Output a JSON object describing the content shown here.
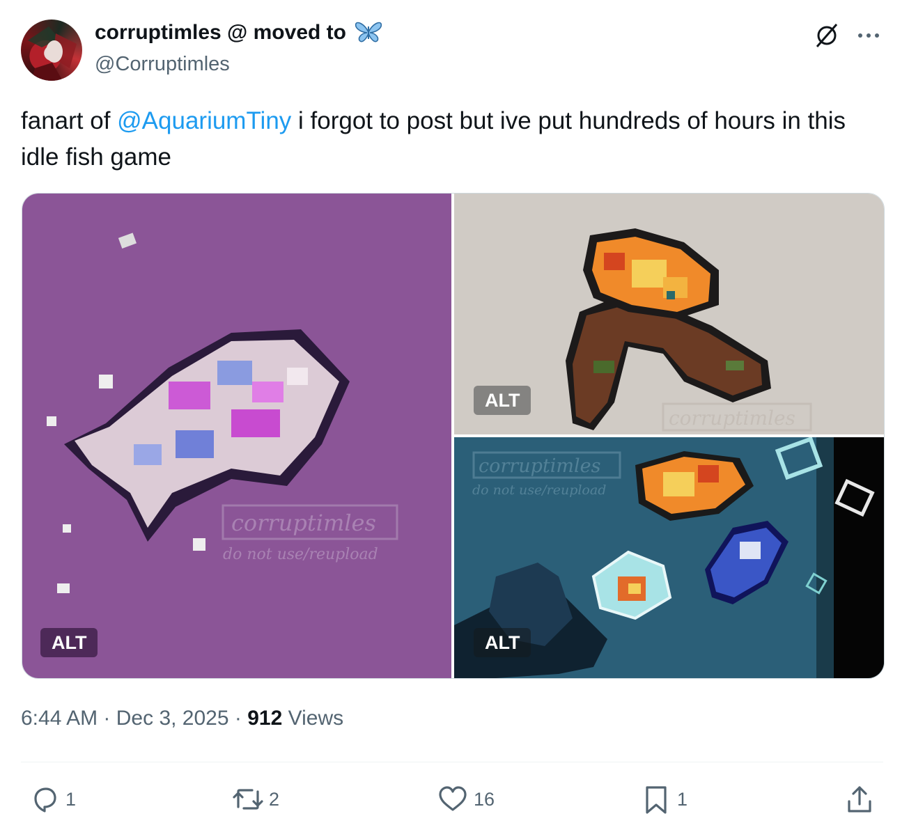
{
  "author": {
    "display_name": "corruptimles @ moved to",
    "display_name_emoji": "butterfly-icon",
    "handle": "@Corruptimles"
  },
  "tweet": {
    "text_before": "fanart of ",
    "mention": "@AquariumTiny",
    "text_after": " i forgot to post but ive put hundreds of hours in this idle fish game"
  },
  "media": {
    "items": [
      {
        "name": "purple-fish-art",
        "alt_label": "ALT",
        "watermark": "corruptimles",
        "watermark_note": "do not use/reupload"
      },
      {
        "name": "fire-fish-boots-art",
        "alt_label": "ALT",
        "watermark": "corruptimles"
      },
      {
        "name": "aquarium-scene-art",
        "alt_label": "ALT",
        "watermark": "corruptimles",
        "watermark_note": "do not use/reupload"
      }
    ]
  },
  "meta": {
    "time": "6:44 AM",
    "separator": "·",
    "date": "Dec 3, 2025",
    "views_count": "912",
    "views_label": "Views"
  },
  "actions": {
    "replies": "1",
    "reposts": "2",
    "likes": "16",
    "bookmarks": "1"
  },
  "colors": {
    "accent": "#1d9bf0",
    "secondary_text": "#536471",
    "primary_text": "#0f1419",
    "divider": "#eff3f4"
  }
}
